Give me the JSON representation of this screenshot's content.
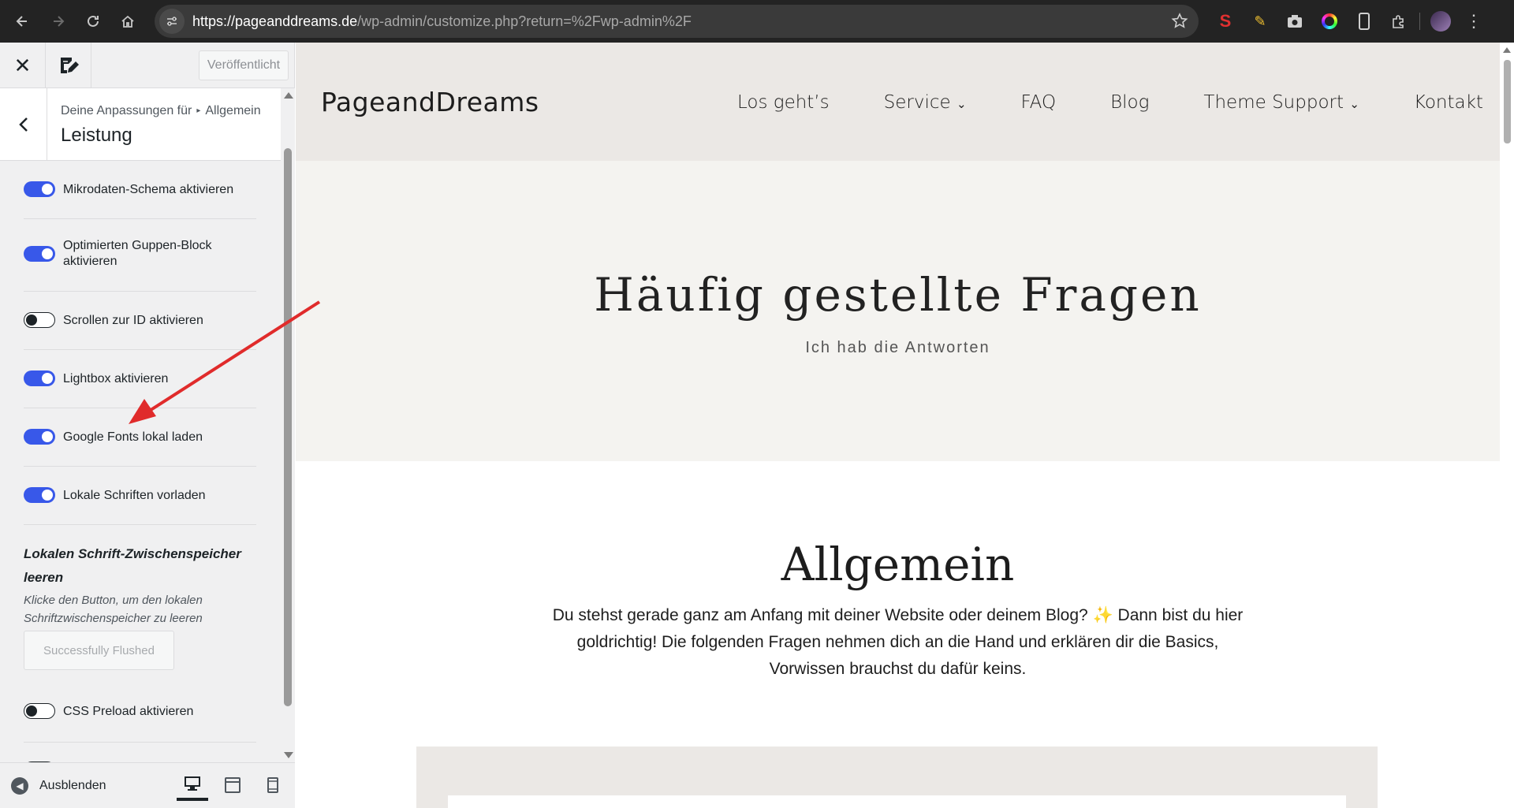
{
  "browser": {
    "url_host": "https://pageanddreams.de",
    "url_path": "/wp-admin/customize.php?return=%2Fwp-admin%2F"
  },
  "customizer": {
    "publish_label": "Veröffentlicht",
    "breadcrumb_prefix": "Deine Anpassungen für",
    "breadcrumb_parent": "Allgemein",
    "section_title": "Leistung",
    "toggles": [
      {
        "label": "Mikrodaten-Schema aktivieren",
        "on": true
      },
      {
        "label": "Optimierten Guppen-Block aktivieren",
        "on": true
      },
      {
        "label": "Scrollen zur ID aktivieren",
        "on": false
      },
      {
        "label": "Lightbox aktivieren",
        "on": true
      },
      {
        "label": "Google Fonts lokal laden",
        "on": true
      },
      {
        "label": "Lokale Schriften vorladen",
        "on": true
      }
    ],
    "flush_title": "Lokalen Schrift-Zwischenspeicher leeren",
    "flush_desc": "Klicke den Button, um den lokalen Schriftzwischenspeicher zu leeren",
    "flush_button": "Successfully Flushed",
    "toggle_css_preload": {
      "label": "CSS Preload aktivieren",
      "on": false
    },
    "footer_collapse": "Ausblenden"
  },
  "site": {
    "logo": "PageandDreams",
    "nav": [
      "Los geht’s",
      "Service",
      "FAQ",
      "Blog",
      "Theme Support",
      "Kontakt"
    ],
    "hero_title": "Häufig gestellte Fragen",
    "hero_subtitle": "Ich hab die Antworten",
    "section_title": "Allgemein",
    "section_text": "Du stehst gerade ganz am Anfang mit deiner Website oder deinem Blog? ✨ Dann bist du hier goldrichtig! Die folgenden Fragen nehmen dich an die Hand und erklären dir die Basics, Vorwissen brauchst du dafür keins."
  },
  "colors": {
    "toggle_on": "#3858e9",
    "header_bg": "#ebe8e5",
    "hero_bg": "#f4f3f0",
    "annotation_arrow": "#e02b2b"
  }
}
